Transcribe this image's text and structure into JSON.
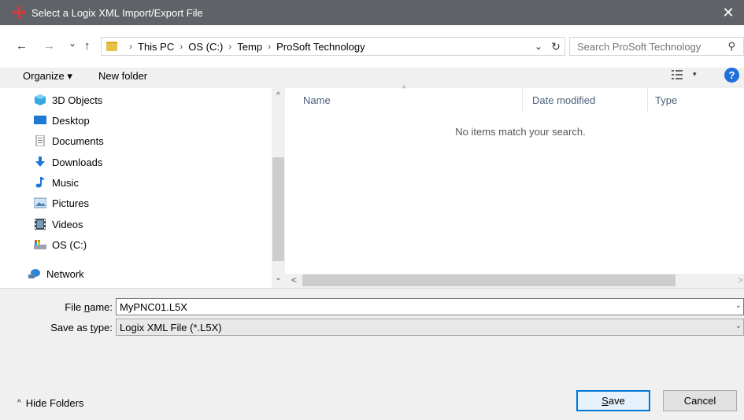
{
  "window": {
    "title": "Select a Logix XML Import/Export File",
    "close_glyph": "✕",
    "icon": "logix-app-icon"
  },
  "address": {
    "back": "←",
    "forward": "→",
    "recent": "⌄",
    "up": "↑",
    "breadcrumbs": [
      "This PC",
      "OS (C:)",
      "Temp",
      "ProSoft Technology"
    ],
    "separator": "›",
    "dropdown_glyph": "⌄",
    "refresh_glyph": "↻",
    "search_placeholder": "Search ProSoft Technology",
    "search_glyph": "⚲"
  },
  "toolbar": {
    "organize": "Organize ▾",
    "new_folder": "New folder",
    "view_dropdown": "▾",
    "help": "?"
  },
  "nav": {
    "items": [
      {
        "label": "3D Objects",
        "icon": "cube-icon"
      },
      {
        "label": "Desktop",
        "icon": "desktop-icon"
      },
      {
        "label": "Documents",
        "icon": "documents-icon"
      },
      {
        "label": "Downloads",
        "icon": "download-icon"
      },
      {
        "label": "Music",
        "icon": "music-icon"
      },
      {
        "label": "Pictures",
        "icon": "pictures-icon"
      },
      {
        "label": "Videos",
        "icon": "videos-icon"
      },
      {
        "label": "OS (C:)",
        "icon": "drive-icon"
      },
      {
        "label": "Network",
        "icon": "network-icon"
      }
    ],
    "scroll_up": "^",
    "scroll_down": "⌄"
  },
  "files": {
    "columns": [
      "Name",
      "Date modified",
      "Type"
    ],
    "sort_caret": "^",
    "empty_message": "No items match your search.",
    "scroll_left": "<",
    "scroll_right": ">"
  },
  "form": {
    "filename_label_pre": "File ",
    "filename_label_key": "n",
    "filename_label_post": "ame:",
    "filename_value": "MyPNC01.L5X",
    "savetype_label_pre": "Save as ",
    "savetype_label_key": "t",
    "savetype_label_post": "ype:",
    "savetype_value": "Logix XML File (*.L5X)",
    "dropdown_glyph": "⌄"
  },
  "footer": {
    "hide_folders_glyph": "^",
    "hide_folders": "Hide Folders",
    "save_key": "S",
    "save_rest": "ave",
    "cancel": "Cancel"
  },
  "colors": {
    "titlebar": "#5f6368",
    "accent": "#0078d7",
    "column_header": "#4c607a",
    "help": "#1e6fd9"
  }
}
